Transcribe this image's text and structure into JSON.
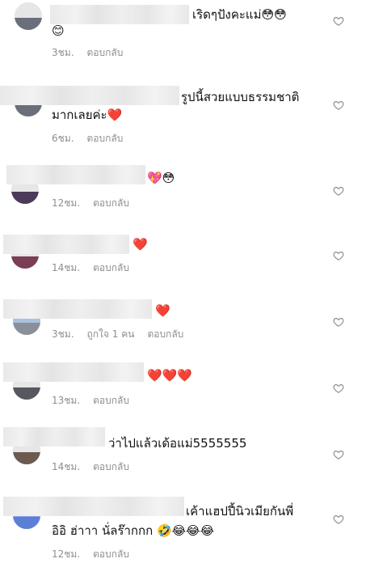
{
  "reply_label": "ตอบกลับ",
  "comments": [
    {
      "text_line1": "เริดๆปังคะแม่",
      "emoji_line1": "😳😳",
      "text_line2": "",
      "emoji_line2": "😊",
      "time": "3ชม.",
      "likes": ""
    },
    {
      "text_line1": "รูปนี้สวยแบบธรรมชาติ",
      "emoji_line1": "",
      "text_line2": "มากเลยค่ะ",
      "emoji_line2": "❤️",
      "time": "6ชม.",
      "likes": ""
    },
    {
      "text_line1": "",
      "emoji_line1": "💖😳",
      "text_line2": "",
      "emoji_line2": "",
      "time": "12ชม.",
      "likes": ""
    },
    {
      "text_line1": "",
      "emoji_line1": "❤️",
      "text_line2": "",
      "emoji_line2": "",
      "time": "14ชม.",
      "likes": ""
    },
    {
      "text_line1": "",
      "emoji_line1": "❤️",
      "text_line2": "",
      "emoji_line2": "",
      "time": "3ชม.",
      "likes": "ถูกใจ 1 คน"
    },
    {
      "text_line1": "",
      "emoji_line1": "❤️❤️❤️",
      "text_line2": "",
      "emoji_line2": "",
      "time": "13ชม.",
      "likes": ""
    },
    {
      "text_line1": "ว่าไปแล้วเด้อแม่5555555",
      "emoji_line1": "",
      "text_line2": "",
      "emoji_line2": "",
      "time": "14ชม.",
      "likes": ""
    },
    {
      "text_line1": "เค้าแฮปปี้นิวเมียกันพี่",
      "emoji_line1": "",
      "text_line2": "อิอิ ฮ่าาา นั่ลร๊ากกก",
      "emoji_line2": "🤣😂😂😂",
      "time": "12ชม.",
      "likes": ""
    }
  ]
}
